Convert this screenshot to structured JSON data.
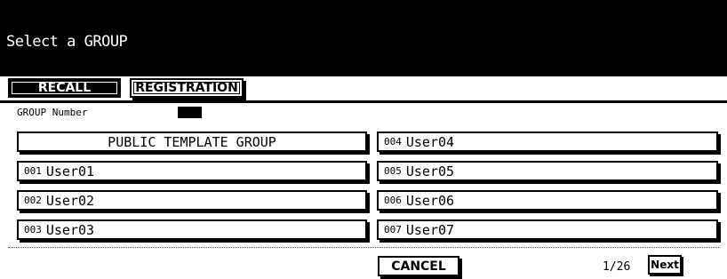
{
  "header": {
    "title": "Select a GROUP"
  },
  "tabs": {
    "recall": "RECALL",
    "registration": "REGISTRATION"
  },
  "group_number": {
    "label": "GROUP Number"
  },
  "groups": {
    "public": "PUBLIC TEMPLATE GROUP",
    "items": [
      {
        "num": "001",
        "name": "User01"
      },
      {
        "num": "002",
        "name": "User02"
      },
      {
        "num": "003",
        "name": "User03"
      },
      {
        "num": "004",
        "name": "User04"
      },
      {
        "num": "005",
        "name": "User05"
      },
      {
        "num": "006",
        "name": "User06"
      },
      {
        "num": "007",
        "name": "User07"
      }
    ]
  },
  "footer": {
    "cancel": "CANCEL",
    "page": "1/26",
    "next": "Next"
  }
}
